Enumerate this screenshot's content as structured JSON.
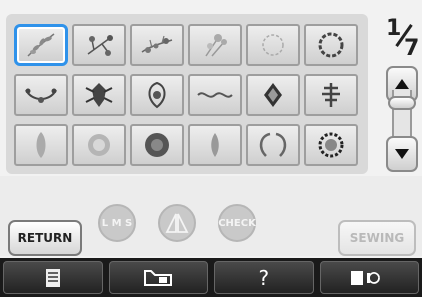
{
  "page_indicator": {
    "current": "1",
    "total": "7"
  },
  "patterns": [
    {
      "icon": "floral-sprig-icon",
      "selected": true
    },
    {
      "icon": "floral-spray-icon",
      "selected": false
    },
    {
      "icon": "floral-branch-icon",
      "selected": false
    },
    {
      "icon": "floral-bouquet-icon",
      "selected": false
    },
    {
      "icon": "floral-ring-icon",
      "selected": false
    },
    {
      "icon": "floral-wreath-icon",
      "selected": false
    },
    {
      "icon": "floral-swag-icon",
      "selected": false
    },
    {
      "icon": "ornament-crest-icon",
      "selected": false
    },
    {
      "icon": "ornament-medallion-icon",
      "selected": false
    },
    {
      "icon": "ornament-border-icon",
      "selected": false
    },
    {
      "icon": "ornament-diamond-icon",
      "selected": false
    },
    {
      "icon": "ornament-tree-icon",
      "selected": false
    },
    {
      "icon": "ornament-vase-icon",
      "selected": false
    },
    {
      "icon": "ornament-lace-icon",
      "selected": false
    },
    {
      "icon": "ornament-rosette-icon",
      "selected": false
    },
    {
      "icon": "ornament-drop-icon",
      "selected": false
    },
    {
      "icon": "floral-laurel-icon",
      "selected": false
    },
    {
      "icon": "ornament-frame-icon",
      "selected": false
    }
  ],
  "buttons": {
    "return": "RETURN",
    "lms": "L M S",
    "check": "CHECK",
    "sewing": "SEWING"
  },
  "bottom_bar": {
    "page_icon": "page-icon",
    "machine_icon": "sewing-machine-icon",
    "help": "?",
    "bobbin_icon": "bobbin-icon"
  }
}
